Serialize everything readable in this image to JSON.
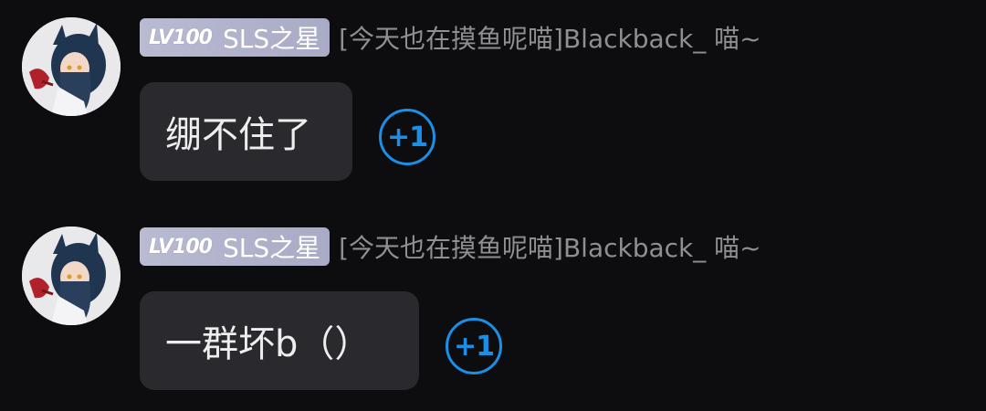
{
  "colors": {
    "background": "#0d0d0f",
    "bubble": "#2a2a2e",
    "bubble_text": "#eeeeee",
    "nickname": "#8e8e93",
    "badge": "#b3b5cd",
    "plus_one_accent": "#1a8fe8"
  },
  "messages": [
    {
      "avatar_icon": "anime-character-avatar",
      "level_badge": "LV100",
      "title_badge": "SLS之星",
      "nickname": "[今天也在摸鱼呢喵]Blackback_ 喵~",
      "text": "绷不住了",
      "plus_one": "+1"
    },
    {
      "avatar_icon": "anime-character-avatar",
      "level_badge": "LV100",
      "title_badge": "SLS之星",
      "nickname": "[今天也在摸鱼呢喵]Blackback_ 喵~",
      "text": "一群坏b（）",
      "plus_one": "+1"
    }
  ]
}
